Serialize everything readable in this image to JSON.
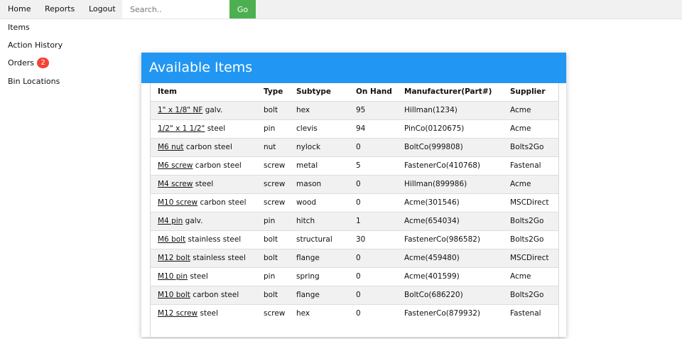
{
  "nav": {
    "home": "Home",
    "reports": "Reports",
    "logout": "Logout",
    "search_placeholder": "Search..",
    "go": "Go"
  },
  "sidebar": {
    "items": "Items",
    "action_history": "Action History",
    "orders": "Orders",
    "orders_badge": "2",
    "bin_locations": "Bin Locations"
  },
  "panel": {
    "title": "Available Items"
  },
  "table": {
    "headers": [
      "Item",
      "Type",
      "Subtype",
      "On Hand",
      "Manufacturer(Part#)",
      "Supplier"
    ],
    "rows": [
      {
        "link": "1\" x 1/8\" NF",
        "desc": " galv.",
        "type": "bolt",
        "subtype": "hex",
        "on_hand": "95",
        "manufacturer": "Hillman(1234)",
        "supplier": "Acme"
      },
      {
        "link": "1/2\" x 1 1/2\"",
        "desc": " steel",
        "type": "pin",
        "subtype": "clevis",
        "on_hand": "94",
        "manufacturer": "PinCo(0120675)",
        "supplier": "Acme"
      },
      {
        "link": "M6 nut",
        "desc": " carbon steel",
        "type": "nut",
        "subtype": "nylock",
        "on_hand": "0",
        "manufacturer": "BoltCo(999808)",
        "supplier": "Bolts2Go"
      },
      {
        "link": "M6 screw",
        "desc": " carbon steel",
        "type": "screw",
        "subtype": "metal",
        "on_hand": "5",
        "manufacturer": "FastenerCo(410768)",
        "supplier": "Fastenal"
      },
      {
        "link": "M4 screw",
        "desc": " steel",
        "type": "screw",
        "subtype": "mason",
        "on_hand": "0",
        "manufacturer": "Hillman(899986)",
        "supplier": "Acme"
      },
      {
        "link": "M10 screw",
        "desc": " carbon steel",
        "type": "screw",
        "subtype": "wood",
        "on_hand": "0",
        "manufacturer": "Acme(301546)",
        "supplier": "MSCDirect"
      },
      {
        "link": "M4 pin",
        "desc": " galv.",
        "type": "pin",
        "subtype": "hitch",
        "on_hand": "1",
        "manufacturer": "Acme(654034)",
        "supplier": "Bolts2Go"
      },
      {
        "link": "M6 bolt",
        "desc": " stainless steel",
        "type": "bolt",
        "subtype": "structural",
        "on_hand": "30",
        "manufacturer": "FastenerCo(986582)",
        "supplier": "Bolts2Go"
      },
      {
        "link": "M12 bolt",
        "desc": " stainless steel",
        "type": "bolt",
        "subtype": "flange",
        "on_hand": "0",
        "manufacturer": "Acme(459480)",
        "supplier": "MSCDirect"
      },
      {
        "link": "M10 pin",
        "desc": " steel",
        "type": "pin",
        "subtype": "spring",
        "on_hand": "0",
        "manufacturer": "Acme(401599)",
        "supplier": "Acme"
      },
      {
        "link": "M10 bolt",
        "desc": " carbon steel",
        "type": "bolt",
        "subtype": "flange",
        "on_hand": "0",
        "manufacturer": "BoltCo(686220)",
        "supplier": "Bolts2Go"
      },
      {
        "link": "M12 screw",
        "desc": " steel",
        "type": "screw",
        "subtype": "hex",
        "on_hand": "0",
        "manufacturer": "FastenerCo(879932)",
        "supplier": "Fastenal"
      }
    ]
  },
  "colors": {
    "header_blue": "#2196f3",
    "go_green": "#4caf50",
    "badge_red": "#f44336",
    "nav_gray": "#f1f1f1"
  }
}
